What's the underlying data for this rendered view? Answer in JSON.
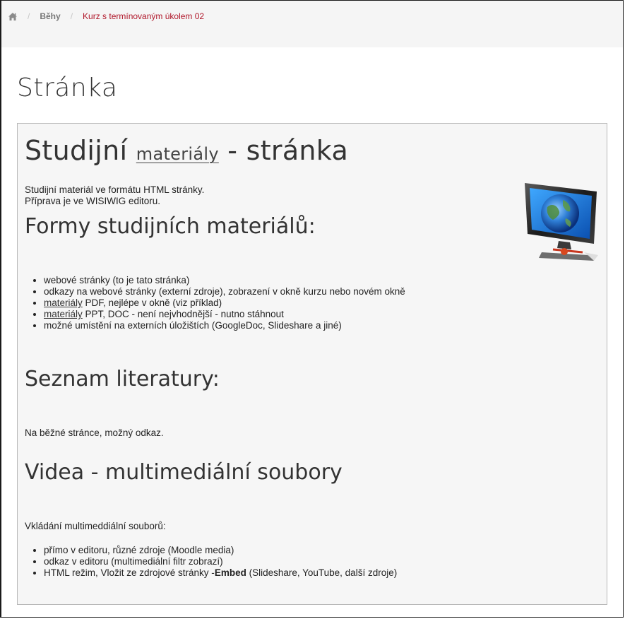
{
  "breadcrumb": {
    "home_icon": "home-icon",
    "separator": "/",
    "items": [
      {
        "label": "Běhy"
      },
      {
        "label": "Kurz s termínovaným úkolem 02"
      }
    ]
  },
  "page": {
    "title": "Stránka"
  },
  "content": {
    "heading_part1": "Studijní ",
    "heading_link": "materiály",
    "heading_part2": " - stránka",
    "intro_line1": "Studijní materiál ve formátu HTML stránky.",
    "intro_line2": "Příprava je ve WISIWIG editoru.",
    "monitor_icon": "monitor-globe-icon",
    "forms": {
      "heading": "Formy studijních materiálů:",
      "items": [
        {
          "text": "webové stránky (to je tato stránka)"
        },
        {
          "text": "odkazy na webové stránky (externí zdroje), zobrazení v okně kurzu nebo novém okně"
        },
        {
          "link": "materiály",
          "text": " PDF, nejlépe v okně (viz příklad)"
        },
        {
          "link": "materiály",
          "text": " PPT, DOC - není nejvhodnější - nutno stáhnout"
        },
        {
          "text": "možné umístění na externích úložištích (GoogleDoc, Slideshare a jiné)"
        }
      ]
    },
    "literature": {
      "heading": "Seznam literatury:",
      "text": "Na běžné stránce, možný odkaz."
    },
    "video": {
      "heading": "Videa - multimediální soubory",
      "intro": "Vkládání multimeddiální souborů:",
      "items": [
        {
          "text": "přímo v editoru, různé zdroje (Moodle media)"
        },
        {
          "text": "odkaz v editoru (multimediální filtr zobrazí)"
        },
        {
          "pre": "HTML režim, Vložit ze zdrojové stránky -",
          "bold": "Embed",
          "post": " (Slideshare, YouTube, další zdroje)"
        }
      ]
    }
  }
}
